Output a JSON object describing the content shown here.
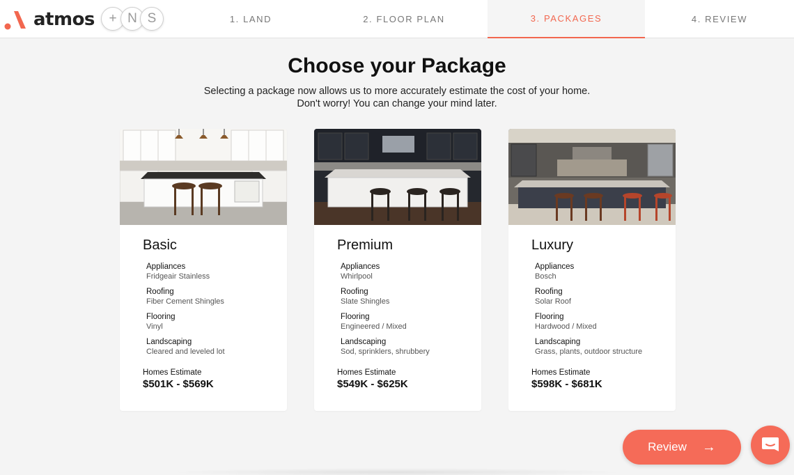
{
  "brand": {
    "name": "atmos",
    "accent": "#f2674f"
  },
  "badges": [
    "+",
    "N",
    "S"
  ],
  "steps": [
    {
      "label": "1. LAND"
    },
    {
      "label": "2. FLOOR PLAN"
    },
    {
      "label": "3. PACKAGES",
      "active": true
    },
    {
      "label": "4. REVIEW"
    }
  ],
  "page": {
    "title": "Choose your Package",
    "subtitle_line1": "Selecting a package now allows us to more accurately estimate the cost of your home.",
    "subtitle_line2": "Don't worry! You can change your mind later."
  },
  "packages": [
    {
      "name": "Basic",
      "features": [
        {
          "label": "Appliances",
          "value": "Fridgeair Stainless"
        },
        {
          "label": "Roofing",
          "value": "Fiber Cement Shingles"
        },
        {
          "label": "Flooring",
          "value": "Vinyl"
        },
        {
          "label": "Landscaping",
          "value": "Cleared and leveled lot"
        }
      ],
      "estimate_label": "Homes Estimate",
      "estimate": "$501K - $569K"
    },
    {
      "name": "Premium",
      "features": [
        {
          "label": "Appliances",
          "value": "Whirlpool"
        },
        {
          "label": "Roofing",
          "value": "Slate Shingles"
        },
        {
          "label": "Flooring",
          "value": "Engineered / Mixed"
        },
        {
          "label": "Landscaping",
          "value": "Sod, sprinklers, shrubbery"
        }
      ],
      "estimate_label": "Homes Estimate",
      "estimate": "$549K - $625K"
    },
    {
      "name": "Luxury",
      "features": [
        {
          "label": "Appliances",
          "value": "Bosch"
        },
        {
          "label": "Roofing",
          "value": "Solar Roof"
        },
        {
          "label": "Flooring",
          "value": "Hardwood / Mixed"
        },
        {
          "label": "Landscaping",
          "value": "Grass, plants, outdoor structure"
        }
      ],
      "estimate_label": "Homes Estimate",
      "estimate": "$598K - $681K"
    }
  ],
  "actions": {
    "review_label": "Review",
    "review_icon": "arrow-right-icon",
    "chat_icon": "chat-icon"
  }
}
